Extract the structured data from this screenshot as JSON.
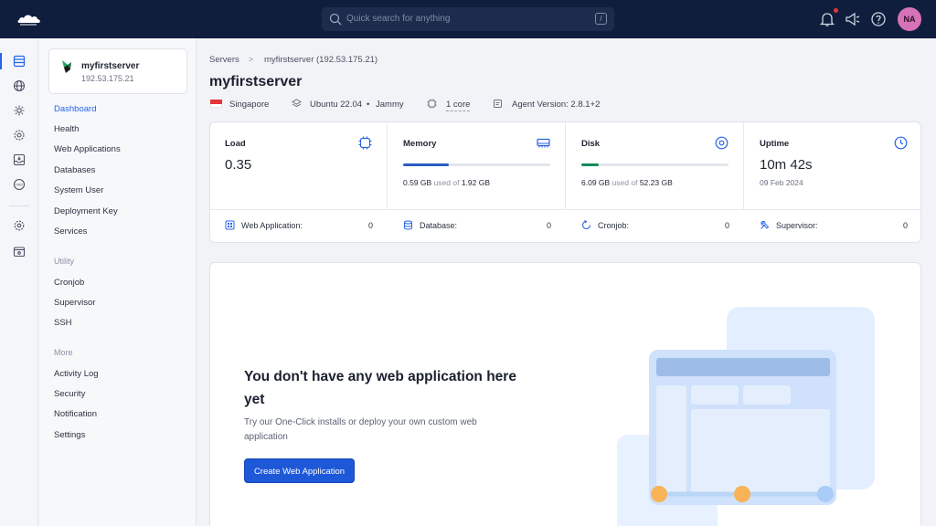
{
  "topbar": {
    "search_placeholder": "Quick search for anything",
    "search_shortcut": "/",
    "avatar_initials": "NA",
    "icons": [
      "bell-icon",
      "megaphone-icon",
      "help-icon"
    ],
    "notification_dot_color": "#e5343b"
  },
  "rail": {
    "icons": [
      "servers-icon",
      "globe-icon",
      "settings-gear-icon",
      "cog-icon",
      "inbox-icon",
      "dns-icon",
      "gear-icon",
      "archive-icon"
    ]
  },
  "sidebar": {
    "server_name": "myfirstserver",
    "server_ip": "192.53.175.21",
    "items": [
      {
        "label": "Dashboard",
        "active": true
      },
      {
        "label": "Health"
      },
      {
        "label": "Web Applications"
      },
      {
        "label": "Databases"
      },
      {
        "label": "System User"
      },
      {
        "label": "Deployment Key"
      },
      {
        "label": "Services"
      }
    ],
    "utility_title": "Utility",
    "utility": [
      {
        "label": "Cronjob"
      },
      {
        "label": "Supervisor"
      },
      {
        "label": "SSH"
      }
    ],
    "more_title": "More",
    "more": [
      {
        "label": "Activity Log"
      },
      {
        "label": "Security"
      },
      {
        "label": "Notification"
      },
      {
        "label": "Settings"
      }
    ]
  },
  "breadcrumb": {
    "root": "Servers",
    "separator": ">",
    "current": "myfirstserver (192.53.175.21)"
  },
  "page": {
    "title": "myfirstserver",
    "location": "Singapore",
    "os": "Ubuntu 22.04",
    "os_dot": "•",
    "os_codename": "Jammy",
    "cpu": "1 core",
    "agent": "Agent Version: 2.8.1+2"
  },
  "stats": {
    "load": {
      "label": "Load",
      "value": "0.35"
    },
    "memory": {
      "label": "Memory",
      "used": "0.59 GB",
      "used_of": "used of",
      "total": "1.92 GB",
      "fraction": 0.31,
      "color": "#2b5cc7"
    },
    "disk": {
      "label": "Disk",
      "used": "6.09 GB",
      "used_of": "used of",
      "total": "52.23 GB",
      "fraction": 0.12,
      "color": "#1a8a5a"
    },
    "uptime": {
      "label": "Uptime",
      "value": "10m 42s",
      "date": "09 Feb 2024"
    }
  },
  "counts": [
    {
      "label": "Web Application:",
      "value": "0"
    },
    {
      "label": "Database:",
      "value": "0"
    },
    {
      "label": "Cronjob:",
      "value": "0"
    },
    {
      "label": "Supervisor:",
      "value": "0"
    }
  ],
  "empty_state": {
    "heading": "You don't have any web application here yet",
    "text": "Try our One-Click installs or deploy your own custom web application",
    "button": "Create Web Application"
  },
  "colors": {
    "accent": "#2563eb",
    "topbar": "#0f1e3c",
    "primary_button": "#1d58d8"
  }
}
